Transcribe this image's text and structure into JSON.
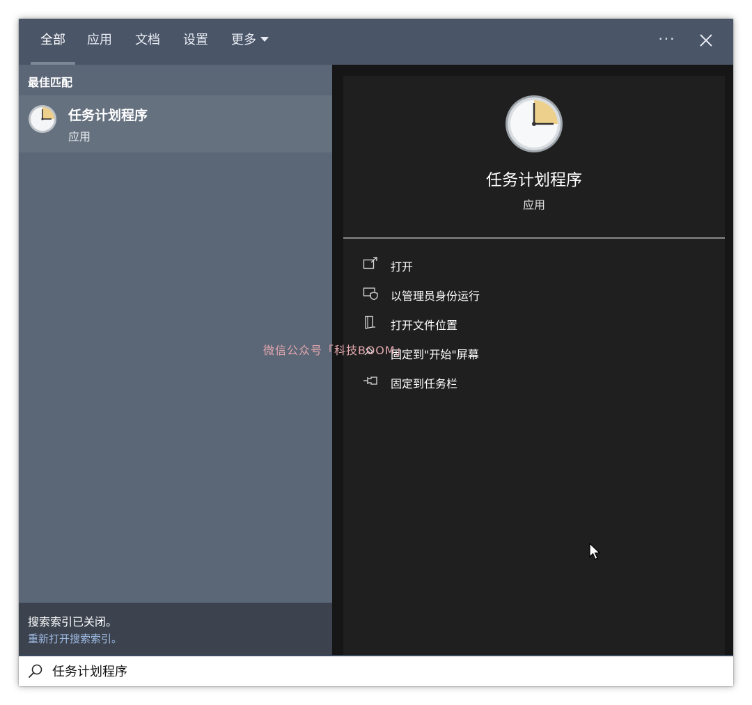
{
  "tabs": [
    {
      "label": "全部",
      "active": true
    },
    {
      "label": "应用",
      "active": false
    },
    {
      "label": "文档",
      "active": false
    },
    {
      "label": "设置",
      "active": false
    },
    {
      "label": "更多",
      "active": false
    }
  ],
  "header": {
    "more_options": "···"
  },
  "left": {
    "section_title": "最佳匹配",
    "best_match": {
      "name": "任务计划程序",
      "type": "应用",
      "icon": "clock-icon"
    },
    "index_notice": {
      "text": "搜索索引已关闭。",
      "link": "重新打开搜索索引。"
    }
  },
  "right": {
    "app_name": "任务计划程序",
    "app_type": "应用",
    "actions": [
      {
        "label": "打开",
        "icon": "open-icon"
      },
      {
        "label": "以管理员身份运行",
        "icon": "run-as-admin-icon"
      },
      {
        "label": "打开文件位置",
        "icon": "file-location-icon"
      },
      {
        "label": "固定到\"开始\"屏幕",
        "icon": "pin-start-icon"
      },
      {
        "label": "固定到任务栏",
        "icon": "pin-taskbar-icon"
      }
    ]
  },
  "watermark": "微信公众号「科技BOOM」",
  "search": {
    "value": "任务计划程序"
  },
  "colors": {
    "tabbar": "#4a5568",
    "left_pane": "#5b6677",
    "right_pane": "#1f1f1f",
    "link": "#9db9e2",
    "clock_face_highlight": "#ecd08b"
  }
}
